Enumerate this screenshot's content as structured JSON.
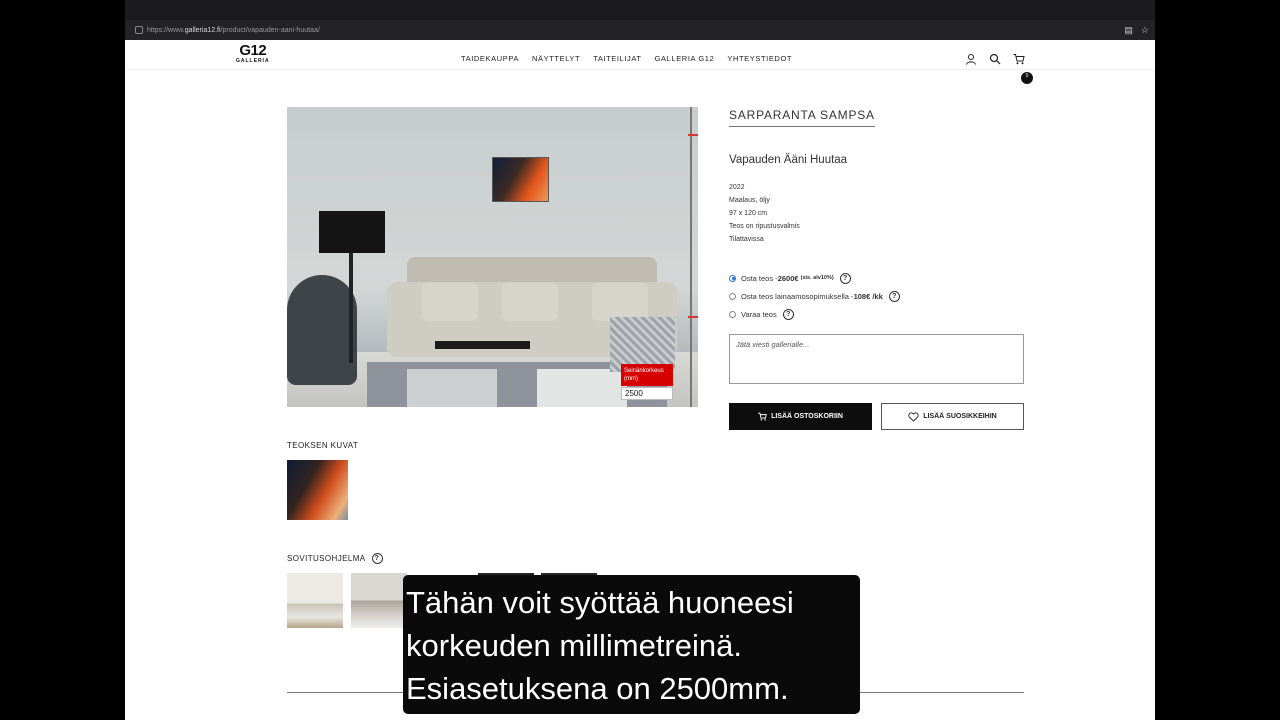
{
  "browser": {
    "url_prefix": "https://www.",
    "url_domain": "galleria12.fi",
    "url_path": "/product/vapauden-aani-huutaa/"
  },
  "header": {
    "logo_top": "G12",
    "logo_bottom": "GALLERIA",
    "nav": [
      "TAIDEKAUPPA",
      "NÄYTTELYT",
      "TAITEILIJAT",
      "GALLERIA G12",
      "YHTEYSTIEDOT"
    ],
    "cart_count": "0"
  },
  "product": {
    "artist": "SARPARANTA SAMPSA",
    "title": "Vapauden Ääni Huutaa",
    "year": "2022",
    "medium": "Maalaus, öljy",
    "size": "97 x 120 cm",
    "hanging": "Teos on ripustusvalmis",
    "availability": "Tilattavissa"
  },
  "room_preview": {
    "wall_height_label": "Seinänkorkeus (mm)",
    "wall_height_value": "2500"
  },
  "options": {
    "buy_label": "Osta teos - ",
    "buy_price": "2600€",
    "buy_vat": "(sis. alv10%)",
    "lease_label": "Osta teos lainaamosopimuksella - ",
    "lease_price": "108€ /kk",
    "reserve_label": "Varaa teos",
    "help": "?"
  },
  "message": {
    "placeholder": "Jätä viesti gallerialle..."
  },
  "buttons": {
    "add_to_cart": "LISÄÄ OSTOSKORIIN",
    "add_to_favorites": "LISÄÄ SUOSIKKEIHIN"
  },
  "sections": {
    "images_title": "TEOKSEN KUVAT",
    "fitting_title": "SOVITUSOHJELMA"
  },
  "subtitle": {
    "lines": [
      "Tähän voit syöttää huoneesi",
      "korkeuden millimetreinä.",
      "Esiasetuksena on 2500mm."
    ]
  }
}
